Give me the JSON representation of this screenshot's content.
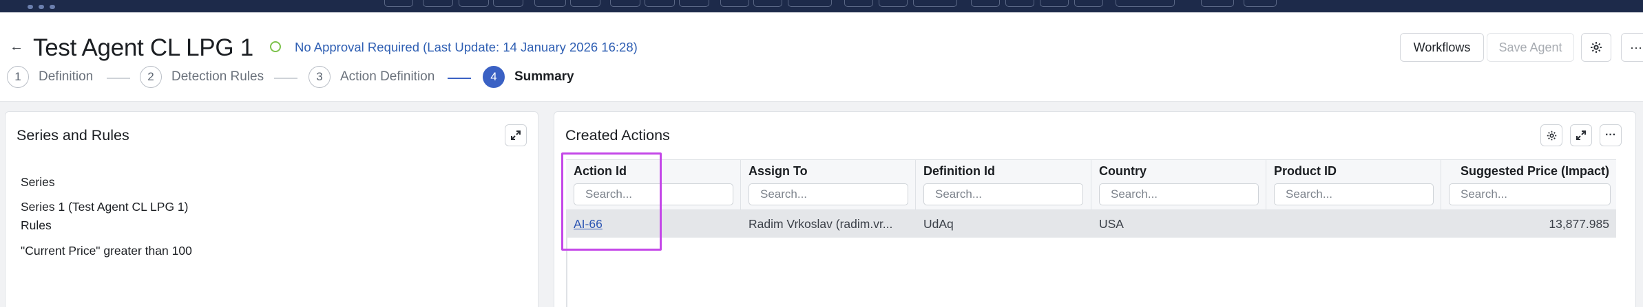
{
  "header": {
    "title": "Test Agent CL LPG 1",
    "status_text": "No Approval Required (Last Update: 14 January 2026 16:28)",
    "buttons": {
      "workflows": "Workflows",
      "save_agent": "Save Agent",
      "more": "···"
    }
  },
  "stepper": [
    {
      "num": "1",
      "label": "Definition"
    },
    {
      "num": "2",
      "label": "Detection Rules"
    },
    {
      "num": "3",
      "label": "Action Definition"
    },
    {
      "num": "4",
      "label": "Summary"
    }
  ],
  "series_panel": {
    "title": "Series and Rules",
    "series_heading": "Series",
    "series_value": "Series 1 (Test Agent CL LPG 1)",
    "rules_heading": "Rules",
    "rules_value": "\"Current Price\" greater than 100"
  },
  "actions_panel": {
    "title": "Created Actions",
    "columns": [
      {
        "header": "Action Id",
        "placeholder": "Search..."
      },
      {
        "header": "Assign To",
        "placeholder": "Search..."
      },
      {
        "header": "Definition Id",
        "placeholder": "Search..."
      },
      {
        "header": "Country",
        "placeholder": "Search..."
      },
      {
        "header": "Product ID",
        "placeholder": "Search..."
      },
      {
        "header": "Suggested Price (Impact)",
        "placeholder": "Search..."
      }
    ],
    "rows": [
      {
        "action_id": "AI-66",
        "assign_to": "Radim Vrkoslav (radim.vr...",
        "definition_id": "UdAq",
        "country": "USA",
        "product_id": "",
        "suggested_price": "13,877.985"
      }
    ]
  },
  "colors": {
    "accent": "#3a61c4",
    "status_ok": "#7cc24b",
    "highlight": "#c447e8",
    "topbar": "#1d2a4a"
  }
}
